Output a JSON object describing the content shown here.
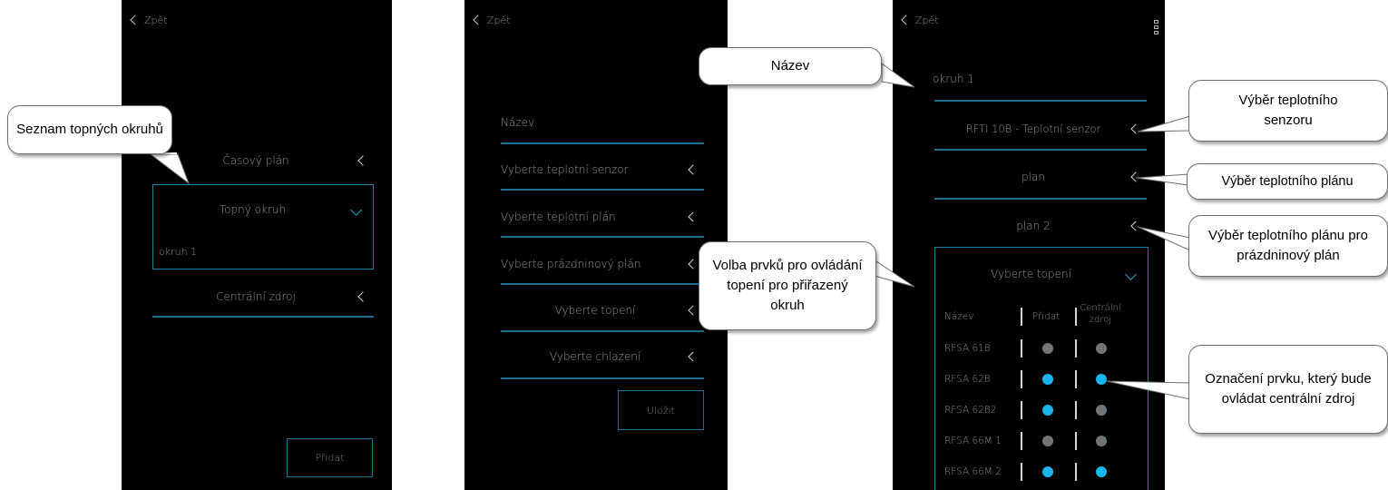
{
  "screen1": {
    "back": "Zpět",
    "items": [
      {
        "label": "Časový plán"
      },
      {
        "label": "Topný okruh",
        "sub": "okruh 1"
      },
      {
        "label": "Centrální zdroj"
      }
    ],
    "add_button": "Přidat"
  },
  "screen2": {
    "back": "Zpět",
    "name_placeholder": "Název",
    "rows": [
      "Vyberte teplotní senzor",
      "Vyberte teplotní plán",
      "Vyberte prázdninový plán",
      "Vyberte topení",
      "Vyberte chlazení"
    ],
    "save_button": "Uložit"
  },
  "screen3": {
    "back": "Zpět",
    "name_value": "okruh 1",
    "sensor": "RFTI 10B - Teplotní senzor",
    "plan": "plan",
    "plan2": "plan 2",
    "heating": {
      "label": "Vyberte topení",
      "headers": {
        "name": "Název",
        "add": "Přidat",
        "central": "Centrální zdroj"
      },
      "rows": [
        {
          "name": "RFSA 61B",
          "add": false,
          "central": false
        },
        {
          "name": "RFSA 62B",
          "add": true,
          "central": true
        },
        {
          "name": "RFSA 62B2",
          "add": true,
          "central": false
        },
        {
          "name": "RFSA 66M 1",
          "add": false,
          "central": false
        },
        {
          "name": "RFSA 66M 2",
          "add": true,
          "central": true
        }
      ]
    }
  },
  "callouts": {
    "list": "Seznam topných okruhů",
    "name": "Název",
    "controls": "Volba prvků pro ovládání topení pro přiřazený okruh",
    "sensor": "Výběr teplotního senzoru",
    "plan": "Výběr teplotního plánu",
    "holiday": "Výběr teplotního plánu pro prázdninový plán",
    "central": "Označení prvku, který bude ovládat centrální zdroj"
  },
  "colors": {
    "accent": "#1ab4ee",
    "line": "#1b6f8f",
    "dot_off": "#6e7477",
    "background": "#000000"
  }
}
